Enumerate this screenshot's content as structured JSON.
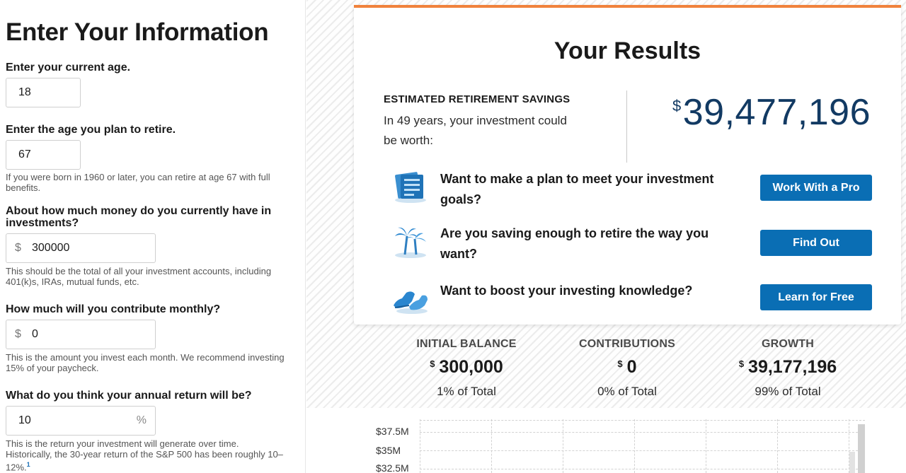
{
  "form": {
    "title": "Enter Your Information",
    "age": {
      "label": "Enter your current age.",
      "value": "18"
    },
    "retire": {
      "label": "Enter the age you plan to retire.",
      "value": "67",
      "hint": "If you were born in 1960 or later, you can retire at age 67 with full benefits."
    },
    "savings": {
      "label": "About how much money do you currently have in investments?",
      "prefix": "$",
      "value": "300000",
      "hint": "This should be the total of all your investment accounts, including 401(k)s, IRAs, mutual funds, etc."
    },
    "monthly": {
      "label": "How much will you contribute monthly?",
      "prefix": "$",
      "value": "0",
      "hint": "This is the amount you invest each month. We recommend investing 15% of your paycheck."
    },
    "return": {
      "label": "What do you think your annual return will be?",
      "value": "10",
      "suffix": "%",
      "hint": "This is the return your investment will generate over time. Historically, the 30-year return of the S&P 500 has been roughly 10–12%.",
      "footnote": "1"
    }
  },
  "results": {
    "title": "Your Results",
    "estimate_title": "ESTIMATED RETIREMENT SAVINGS",
    "estimate_sub": "In 49 years, your investment could be worth:",
    "currency": "$",
    "amount": "39,477,196",
    "ctas": [
      {
        "text": "Want to make a plan to meet your investment goals?",
        "button": "Work With a Pro",
        "icon": "document-icon"
      },
      {
        "text": "Are you saving enough to retire the way you want?",
        "button": "Find Out",
        "icon": "palm-tree-icon"
      },
      {
        "text": "Want to boost your investing knowledge?",
        "button": "Learn for Free",
        "icon": "sneakers-icon"
      }
    ]
  },
  "summary": {
    "initial": {
      "label": "INITIAL BALANCE",
      "currency": "$",
      "amount": "300,000",
      "pct": "1% of Total"
    },
    "contrib": {
      "label": "CONTRIBUTIONS",
      "currency": "$",
      "amount": "0",
      "pct": "0% of Total"
    },
    "growth": {
      "label": "GROWTH",
      "currency": "$",
      "amount": "39,177,196",
      "pct": "99% of Total"
    }
  },
  "chart_data": {
    "type": "bar",
    "y_ticks": [
      "$37.5M",
      "$35M",
      "$32.5M"
    ],
    "title": "",
    "xlabel": "",
    "ylabel": ""
  },
  "colors": {
    "accent": "#f0823c",
    "button": "#0a6eb4",
    "amount": "#123a63"
  }
}
